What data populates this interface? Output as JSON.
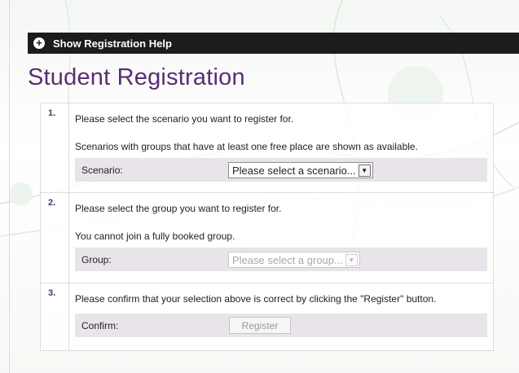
{
  "help_bar": {
    "icon": "plus-circle-icon",
    "label": "Show Registration Help"
  },
  "page": {
    "title": "Student Registration"
  },
  "steps": [
    {
      "number": "1.",
      "lines": [
        "Please select the scenario you want to register for.",
        "Scenarios with groups that have at least one free place are shown as available."
      ],
      "field_label": "Scenario:",
      "select_value": "Please select a scenario...",
      "enabled": true
    },
    {
      "number": "2.",
      "lines": [
        "Please select the group you want to register for.",
        "You cannot join a fully booked group."
      ],
      "field_label": "Group:",
      "select_value": "Please select a group...",
      "enabled": false
    },
    {
      "number": "3.",
      "lines": [
        "Please confirm that your selection above is correct by clicking the \"Register\" button."
      ],
      "field_label": "Confirm:",
      "button_label": "Register",
      "enabled": false
    }
  ],
  "colors": {
    "title": "#5b2d73",
    "help_bar_bg": "#1c1c1c",
    "field_row_bg": "#e9e4ea"
  }
}
